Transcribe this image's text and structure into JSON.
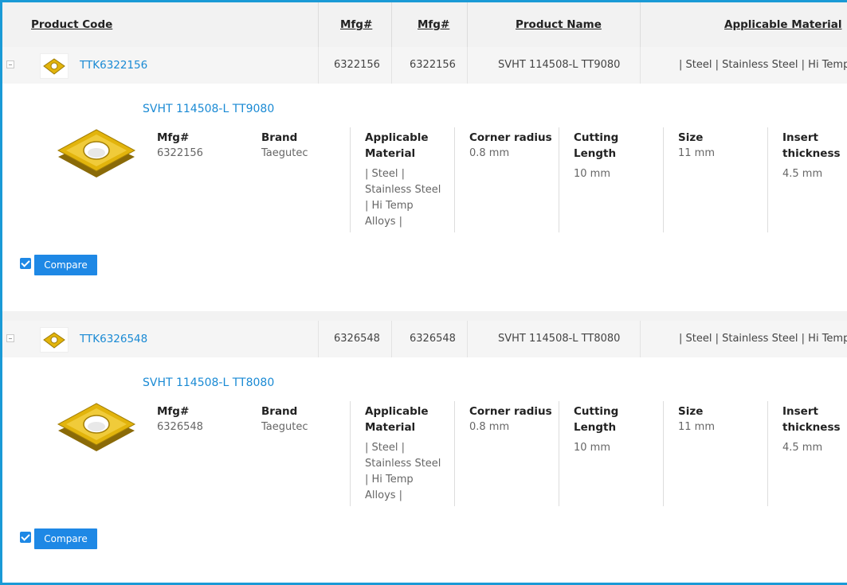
{
  "header": {
    "product_code": "Product Code",
    "mfg1": "Mfg#",
    "mfg2": "Mfg#",
    "product_name": "Product Name",
    "applicable_material": "Applicable Material"
  },
  "labels": {
    "mfg": "Mfg#",
    "brand": "Brand",
    "applicable_material": "Applicable Material",
    "corner_radius": "Corner radius",
    "cutting_length": "Cutting Length",
    "size": "Size",
    "insert_thickness": "Insert thickness",
    "compare": "Compare"
  },
  "products": [
    {
      "code": "TTK6322156",
      "mfg1": "6322156",
      "mfg2": "6322156",
      "name": "SVHT 114508-L TT9080",
      "material": "| Steel | Stainless Steel | Hi Temp A",
      "detail": {
        "title": "SVHT 114508-L TT9080",
        "mfg": "6322156",
        "brand": "Taegutec",
        "material_lines": [
          "| Steel |",
          "Stainless Steel",
          "| Hi Temp",
          "Alloys |"
        ],
        "corner_radius": "0.8 mm",
        "cutting_length": "10 mm",
        "size": "11 mm",
        "insert_thickness": "4.5 mm"
      },
      "compare_checked": true
    },
    {
      "code": "TTK6326548",
      "mfg1": "6326548",
      "mfg2": "6326548",
      "name": "SVHT 114508-L TT8080",
      "material": "| Steel | Stainless Steel | Hi Temp A",
      "detail": {
        "title": "SVHT 114508-L TT8080",
        "mfg": "6326548",
        "brand": "Taegutec",
        "material_lines": [
          "| Steel |",
          "Stainless Steel",
          "| Hi Temp",
          "Alloys |"
        ],
        "corner_radius": "0.8 mm",
        "cutting_length": "10 mm",
        "size": "11 mm",
        "insert_thickness": "4.5 mm"
      },
      "compare_checked": true
    }
  ],
  "colors": {
    "accent": "#1e88e5",
    "link": "#1a8ad4",
    "frame": "#1a9ad6",
    "insert_gold": "#e2b40c"
  }
}
